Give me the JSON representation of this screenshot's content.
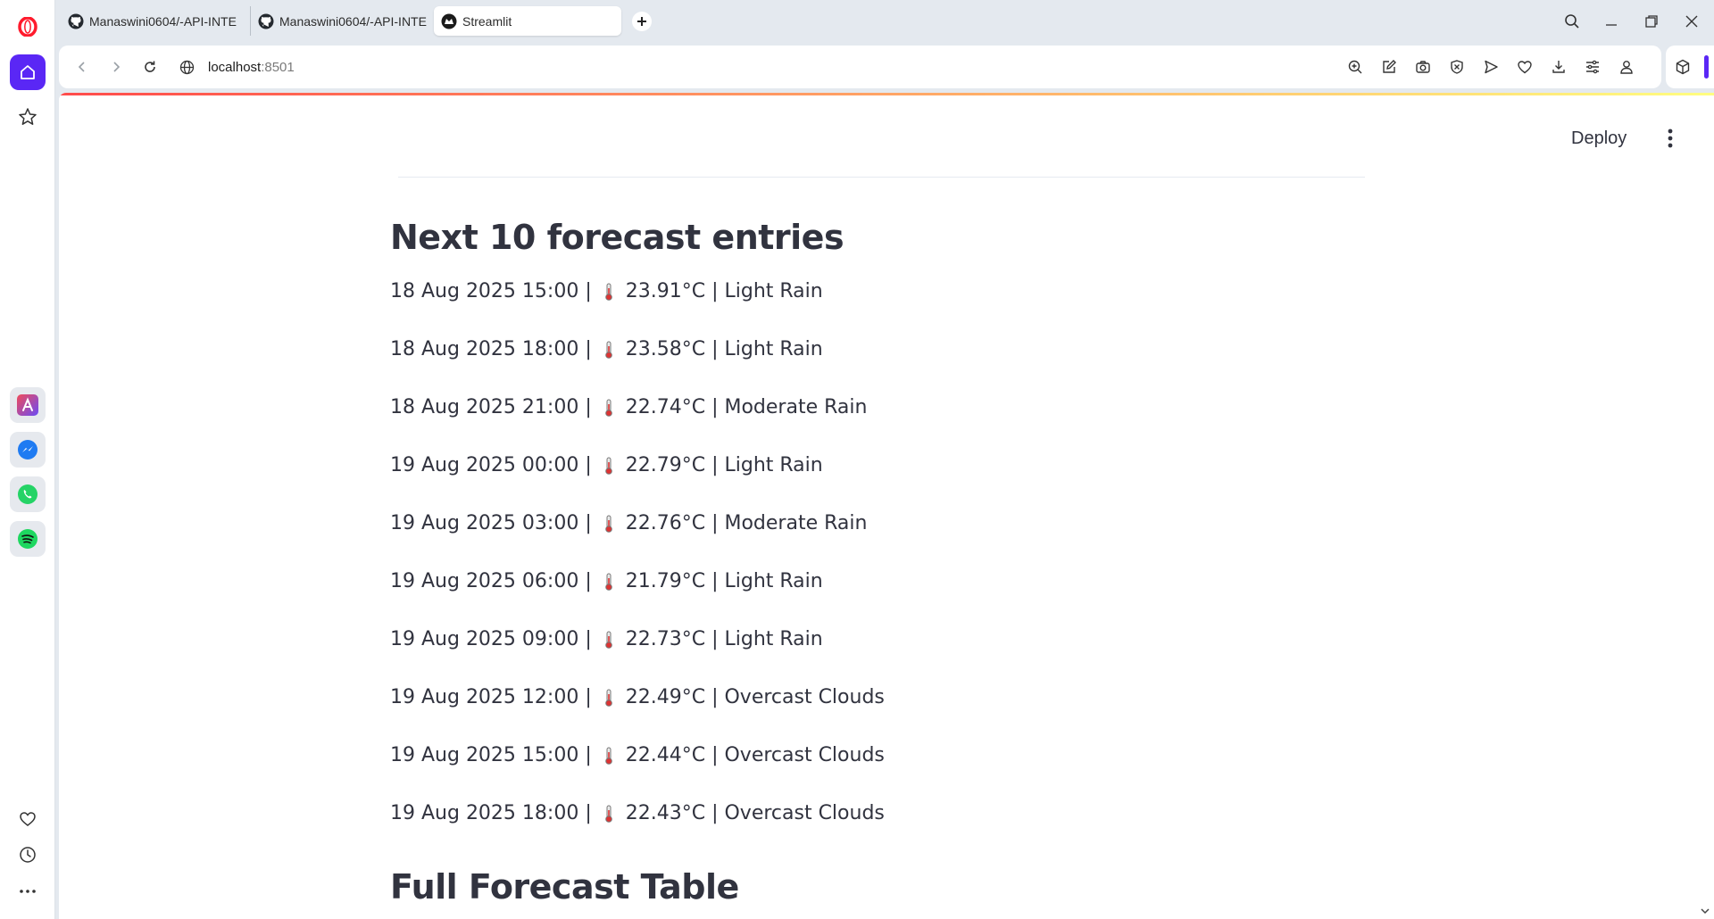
{
  "browser": {
    "tabs": [
      {
        "title": "Manaswini0604/-API-INTE",
        "icon": "github-icon"
      },
      {
        "title": "Manaswini0604/-API-INTE",
        "icon": "github-icon"
      },
      {
        "title": "Streamlit",
        "icon": "streamlit-icon",
        "active": true
      }
    ],
    "url_host": "localhost",
    "url_port": ":8501",
    "accent_color": "#5a27f5"
  },
  "sidebar": {
    "apps": [
      "aria-icon",
      "messenger-icon",
      "whatsapp-icon",
      "spotify-icon"
    ]
  },
  "app": {
    "deploy_label": "Deploy",
    "forecast_heading": "Next 10 forecast entries",
    "entries": [
      {
        "time": "18 Aug 2025 15:00",
        "temp": "23.91°C",
        "desc": "Light Rain"
      },
      {
        "time": "18 Aug 2025 18:00",
        "temp": "23.58°C",
        "desc": "Light Rain"
      },
      {
        "time": "18 Aug 2025 21:00",
        "temp": "22.74°C",
        "desc": "Moderate Rain"
      },
      {
        "time": "19 Aug 2025 00:00",
        "temp": "22.79°C",
        "desc": "Light Rain"
      },
      {
        "time": "19 Aug 2025 03:00",
        "temp": "22.76°C",
        "desc": "Moderate Rain"
      },
      {
        "time": "19 Aug 2025 06:00",
        "temp": "21.79°C",
        "desc": "Light Rain"
      },
      {
        "time": "19 Aug 2025 09:00",
        "temp": "22.73°C",
        "desc": "Light Rain"
      },
      {
        "time": "19 Aug 2025 12:00",
        "temp": "22.49°C",
        "desc": "Overcast Clouds"
      },
      {
        "time": "19 Aug 2025 15:00",
        "temp": "22.44°C",
        "desc": "Overcast Clouds"
      },
      {
        "time": "19 Aug 2025 18:00",
        "temp": "22.43°C",
        "desc": "Overcast Clouds"
      }
    ],
    "table_heading": "Full Forecast Table"
  }
}
